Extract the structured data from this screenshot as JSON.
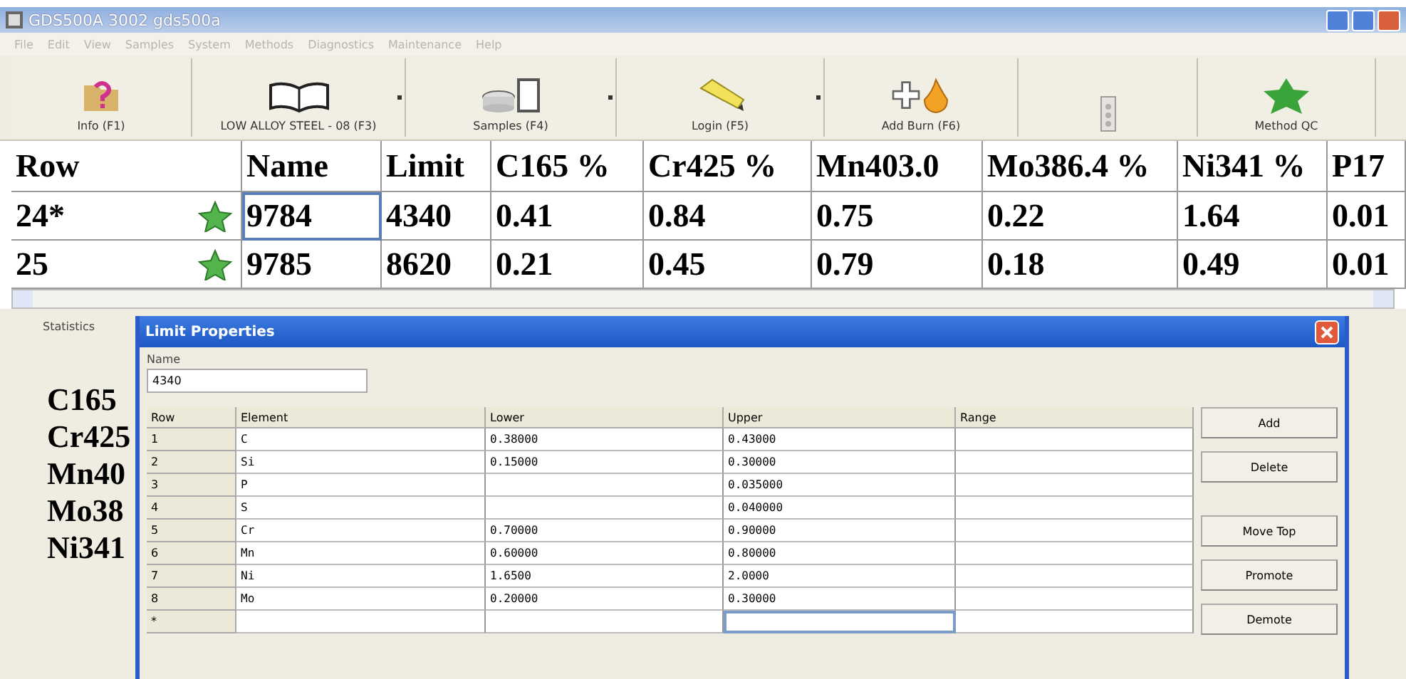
{
  "window": {
    "title": "GDS500A 3002 gds500a"
  },
  "menu": [
    "File",
    "Edit",
    "View",
    "Samples",
    "System",
    "Methods",
    "Diagnostics",
    "Maintenance",
    "Help"
  ],
  "toolbar": [
    {
      "kind": "info",
      "label": "Info (F1)",
      "dropdown": false,
      "disabled": false
    },
    {
      "kind": "book",
      "label": "LOW ALLOY STEEL - 08 (F3)",
      "dropdown": true,
      "disabled": false
    },
    {
      "kind": "samples",
      "label": "Samples (F4)",
      "dropdown": true,
      "disabled": false
    },
    {
      "kind": "login",
      "label": "Login (F5)",
      "dropdown": true,
      "disabled": false
    },
    {
      "kind": "burn",
      "label": "Add Burn (F6)",
      "dropdown": false,
      "disabled": false
    },
    {
      "kind": "device",
      "dropdown": false,
      "disabled": true
    },
    {
      "kind": "star",
      "label": "Method QC",
      "dropdown": false,
      "disabled": false
    }
  ],
  "grid": {
    "columns": [
      "Row",
      "Name",
      "Limit",
      "C165 %",
      "Cr425 %",
      "Mn403.0",
      "Mo386.4 %",
      "Ni341 %",
      "P17"
    ],
    "rows": [
      {
        "selected": true,
        "cells": [
          "24*",
          "9784",
          "4340",
          "0.41",
          "0.84",
          "0.75",
          "0.22",
          "1.64",
          "0.01"
        ]
      },
      {
        "selected": false,
        "cells": [
          "25",
          "9785",
          "8620",
          "0.21",
          "0.45",
          "0.79",
          "0.18",
          "0.49",
          "0.01"
        ]
      }
    ]
  },
  "statistics": {
    "tab": "Statistics",
    "labels": [
      "C165",
      "Cr425",
      "Mn40",
      "Mo38",
      "Ni341"
    ]
  },
  "dialog": {
    "title": "Limit Properties",
    "name_label": "Name",
    "name_value": "4340",
    "columns": [
      "Row",
      "Element",
      "Lower",
      "Upper",
      "Range"
    ],
    "rows": [
      {
        "row": "1",
        "element": "C",
        "lower": "0.38000",
        "upper": "0.43000"
      },
      {
        "row": "2",
        "element": "Si",
        "lower": "0.15000",
        "upper": "0.30000"
      },
      {
        "row": "3",
        "element": "P",
        "upper": "0.035000"
      },
      {
        "row": "4",
        "element": "S",
        "upper": "0.040000"
      },
      {
        "row": "5",
        "element": "Cr",
        "lower": "0.70000",
        "upper": "0.90000"
      },
      {
        "row": "6",
        "element": "Mn",
        "lower": "0.60000",
        "upper": "0.80000"
      },
      {
        "row": "7",
        "element": "Ni",
        "lower": "1.6500",
        "upper": "2.0000"
      },
      {
        "row": "8",
        "element": "Mo",
        "lower": "0.20000",
        "upper": "0.30000"
      }
    ],
    "new_row": "*",
    "buttons": [
      "Add",
      "Delete",
      "Move Top",
      "Promote",
      "Demote"
    ]
  }
}
